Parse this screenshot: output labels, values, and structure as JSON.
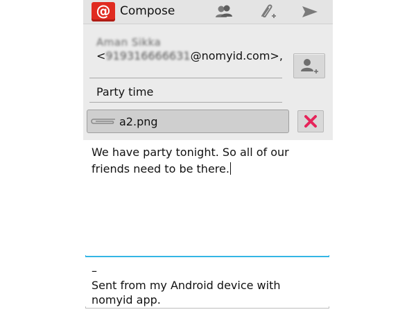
{
  "app": {
    "icon_glyph": "@",
    "title": "Compose",
    "accent_color": "#e02b20"
  },
  "toolbar": {
    "actions": [
      {
        "name": "contacts-icon"
      },
      {
        "name": "attach-icon"
      },
      {
        "name": "send-icon"
      }
    ]
  },
  "compose": {
    "to_name": "Aman Sikka",
    "to_address_prefix": "<",
    "to_address_blurred": "919316666631",
    "to_address_suffix": "@nomyid.com>,",
    "subject": "Party time",
    "attachment": {
      "filename": "a2.png"
    },
    "body": "We have party tonight. So all of our friends need to be there.",
    "signature_separator": "–",
    "signature": "Sent from my Android device with nomyid app."
  },
  "colors": {
    "focus_line": "#33b5e5",
    "remove_x": "#e6245a"
  }
}
